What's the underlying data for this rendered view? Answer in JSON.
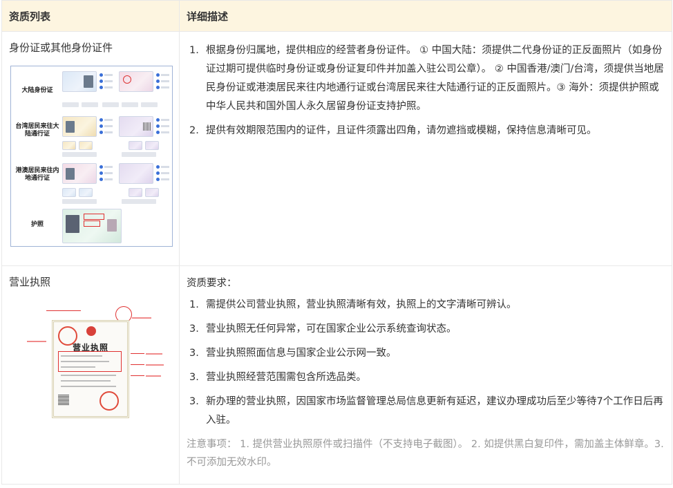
{
  "table": {
    "headers": [
      "资质列表",
      "详细描述"
    ]
  },
  "rows": [
    {
      "name": "身份证或其他身份证件",
      "figure": {
        "labels": [
          "大陆身份证",
          "台湾居民来往大陆通行证",
          "港澳居民来往内地通行证",
          "护照"
        ]
      },
      "items": [
        {
          "num": "1.",
          "text": "根据身份归属地，提供相应的经营者身份证件。 ① 中国大陆：须提供二代身份证的正反面照片（如身份证过期可提供临时身份证或身份证复印件并加盖入驻公司公章）。 ② 中国香港/澳门/台湾，须提供当地居民身份证或港澳居民来往内地通行证或台湾居民来往大陆通行证的正反面照片。③ 海外：须提供护照或中华人民共和国外国人永久居留身份证支持护照。"
        },
        {
          "num": "2.",
          "text": "提供有效期限范围内的证件，且证件须露出四角，请勿遮挡或模糊，保持信息清晰可见。"
        }
      ]
    },
    {
      "name": "营业执照",
      "figure": {
        "title": "营业执照"
      },
      "intro": "资质要求：",
      "items": [
        {
          "num": "1.",
          "text": "需提供公司营业执照，营业执照清晰有效，执照上的文字清晰可辨认。"
        },
        {
          "num": "3.",
          "text": "营业执照无任何异常，可在国家企业公示系统查询状态。"
        },
        {
          "num": "3.",
          "text": "营业执照照面信息与国家企业公示网一致。"
        },
        {
          "num": "3.",
          "text": "营业执照经营范围需包含所选品类。"
        },
        {
          "num": "3.",
          "text": "新办理的营业执照，因国家市场监督管理总局信息更新有延迟，建议办理成功后至少等待7个工作日后再入驻。"
        }
      ],
      "note": "注意事项： 1. 提供营业执照原件或扫描件（不支持电子截图）。 2. 如提供黑白复印件，需加盖主体鲜章。3.不可添加无效水印。"
    }
  ],
  "colors": {
    "header_bg": "#fdf5e0",
    "border": "#e8e8e8",
    "note_text": "#999999",
    "accent_red": "#e03030"
  }
}
